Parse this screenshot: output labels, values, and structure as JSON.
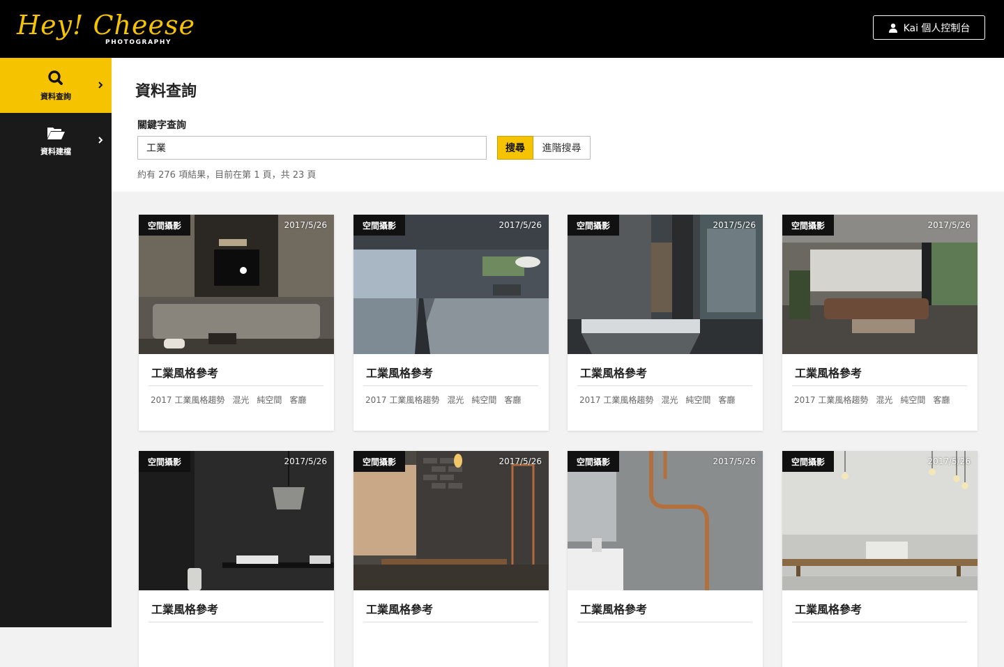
{
  "brand": {
    "logo_text": "Hey!Cheese",
    "logo_sub": "PHOTOGRAPHY"
  },
  "header": {
    "user": "Kai",
    "dashboard_label": "Kai 個人控制台"
  },
  "sidebar": {
    "items": [
      {
        "label": "資料查詢",
        "icon": "search-icon",
        "active": true
      },
      {
        "label": "資料建檔",
        "icon": "folder-open-icon",
        "active": false
      }
    ]
  },
  "page": {
    "title": "資料查詢",
    "keyword_label": "關鍵字查詢",
    "search_value": "工業",
    "search_button": "搜尋",
    "advanced_button": "進階搜尋",
    "result_info": "約有 276 項結果，目前在第 1 頁，共 23 頁"
  },
  "colors": {
    "accent": "#f5c300",
    "topbar": "#000000",
    "sidebar": "#1a1a1a"
  },
  "cards": [
    {
      "category": "空間攝影",
      "date": "2017/5/26",
      "title": "工業風格參考",
      "tags": [
        "2017 工業風格趨勢",
        "混光",
        "純空間",
        "客廳"
      ],
      "scene": "living-dark"
    },
    {
      "category": "空間攝影",
      "date": "2017/5/26",
      "title": "工業風格參考",
      "tags": [
        "2017 工業風格趨勢",
        "混光",
        "純空間",
        "客廳"
      ],
      "scene": "loft-window"
    },
    {
      "category": "空間攝影",
      "date": "2017/5/26",
      "title": "工業風格參考",
      "tags": [
        "2017 工業風格趨勢",
        "混光",
        "純空間",
        "客廳"
      ],
      "scene": "corridor"
    },
    {
      "category": "空間攝影",
      "date": "2017/5/26",
      "title": "工業風格參考",
      "tags": [
        "2017 工業風格趨勢",
        "混光",
        "純空間",
        "客廳"
      ],
      "scene": "lounge"
    },
    {
      "category": "空間攝影",
      "date": "2017/5/26",
      "title": "工業風格參考",
      "tags": [],
      "scene": "black-kitchen"
    },
    {
      "category": "空間攝影",
      "date": "2017/5/26",
      "title": "工業風格參考",
      "tags": [],
      "scene": "brick-dining"
    },
    {
      "category": "空間攝影",
      "date": "2017/5/26",
      "title": "工業風格參考",
      "tags": [],
      "scene": "copper-pipes"
    },
    {
      "category": "空間攝影",
      "date": "2017/5/26",
      "title": "工業風格參考",
      "tags": [],
      "scene": "bulb-table"
    }
  ]
}
